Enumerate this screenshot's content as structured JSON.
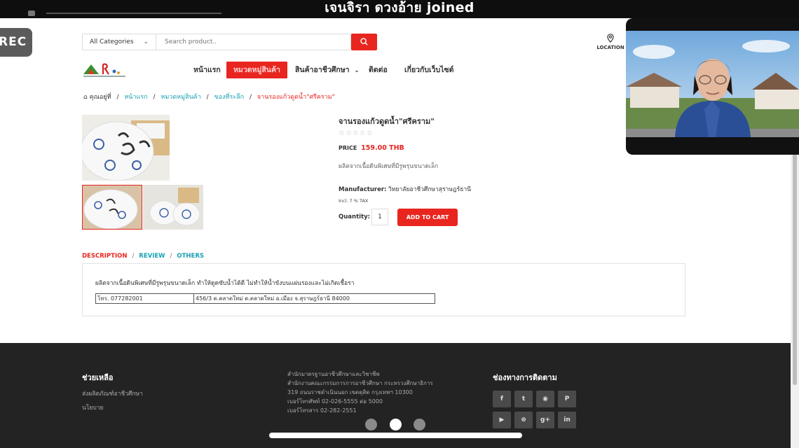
{
  "overlay": {
    "join_notice": "เจนจิรา ดวงอ้าย joined",
    "rec_label": "REC"
  },
  "search": {
    "category": "All Categories",
    "placeholder": "Search product..",
    "location_label": "LOCATION"
  },
  "nav": {
    "items": [
      {
        "label": "หน้าแรก",
        "active": false
      },
      {
        "label": "หมวดหมู่สินค้า",
        "active": true
      },
      {
        "label": "สินค้าอาชีวศึกษา",
        "active": false,
        "dropdown": true
      },
      {
        "label": "ติดต่อ",
        "active": false
      },
      {
        "label": "เกี่ยวกับเว็บไซต์",
        "active": false
      }
    ]
  },
  "breadcrumb": {
    "prefix": "คุณอยู่ที่",
    "items": [
      "หน้าแรก",
      "หมวดหมู่สินค้า",
      "ของที่ระลึก"
    ],
    "current": "จานรองแก้วดูดน้ำ\"ศรีคราม\""
  },
  "product": {
    "title": "จานรองแก้วดูดน้ำ\"ศรีคราม\"",
    "rating_stars": "☆☆☆☆☆",
    "rating": 0,
    "price_label": "PRICE",
    "price": "159.00 THB",
    "short_desc": "ผลิตจากเนื้อดินพิเศษที่มีรูพรุนขนาดเล็ก",
    "manufacturer_label": "Manufacturer:",
    "manufacturer": "วิทยาลัยอาชีวศึกษาสุราษฎร์ธานี",
    "tax_note": "Incl. 7 % TAX",
    "quantity_label": "Quantity:",
    "quantity": "1",
    "add_to_cart": "ADD TO CART"
  },
  "tabs": {
    "items": [
      "DESCRIPTION",
      "REVIEW",
      "OTHERS"
    ],
    "active": "DESCRIPTION"
  },
  "description": {
    "text": "ผลิตจากเนื้อดินพิเศษที่มีรูพรุนขนาดเล็ก ทำให้ดูดซับน้ำได้ดี ไม่ทำให้น้ำขังบนแผ่นรองและไม่เกิดเชื้อรา",
    "phone_cell": "โทร. 077282001",
    "address_cell": "456/3 ต.ตลาดใหม่ ต.ตลาดใหม่ อ.เมือง จ.สุราษฎร์ธานี 84000"
  },
  "footer": {
    "help_heading": "ช่วยเหลือ",
    "help_links": [
      "ส่งผลิตภัณฑ์อาชีวศึกษา",
      "นโยบาย"
    ],
    "address_lines": [
      "สำนักมาตรฐานอาชีวศึกษาและวิชาชีพ",
      "สำนักงานคณะกรรมการการอาชีวศึกษา กระทรวงศึกษาธิการ",
      "319 ถนนราชดำเนินนอก เขตดุสิต กรุงเทพฯ 10300",
      "เบอร์โทรศัพท์ 02-026-5555 ต่อ 5000",
      "เบอร์โทรสาร 02-282-2551"
    ],
    "follow_heading": "ช่องทางการติดตาม",
    "social_icons": [
      "facebook-icon",
      "twitter-icon",
      "rss-icon",
      "pinterest-icon",
      "youtube-icon",
      "dribbble-icon",
      "google-plus-icon",
      "linkedin-icon"
    ],
    "social_glyphs": [
      "f",
      "t",
      "◉",
      "P",
      "▶",
      "⊛",
      "g+",
      "in"
    ]
  },
  "colors": {
    "accent": "#e8251f",
    "link": "#18a0b5",
    "footer_bg": "#232323"
  }
}
